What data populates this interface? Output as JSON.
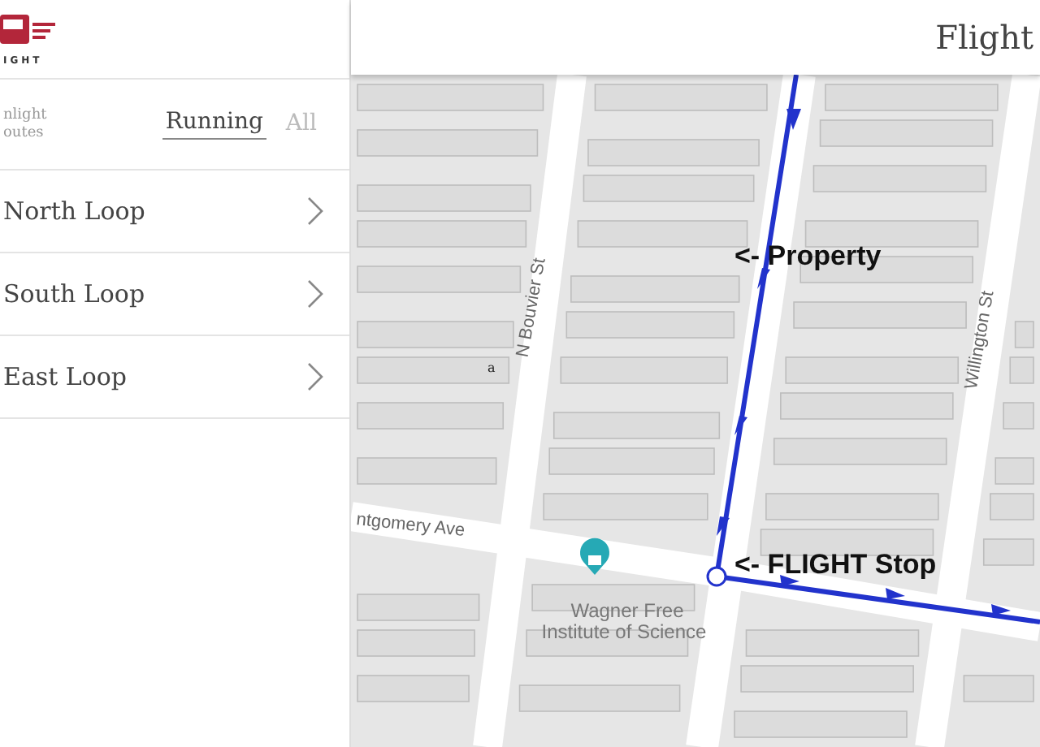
{
  "logo": {
    "text": "IGHT"
  },
  "filter": {
    "label": "nlight outes",
    "tabs": [
      {
        "label": "Running",
        "selected": true
      },
      {
        "label": "All",
        "selected": false
      }
    ]
  },
  "routes": [
    {
      "name": "North Loop"
    },
    {
      "name": "South Loop"
    },
    {
      "name": "East Loop"
    }
  ],
  "map": {
    "title": "Flight",
    "streets": [
      "N Bouvier St",
      "Willington St",
      "ntgomery Ave"
    ],
    "place": {
      "lines": [
        "Wagner Free",
        "Institute of Science"
      ]
    },
    "marker": "a",
    "annotations": [
      "<- Property",
      "<- FLIGHT Stop"
    ]
  }
}
